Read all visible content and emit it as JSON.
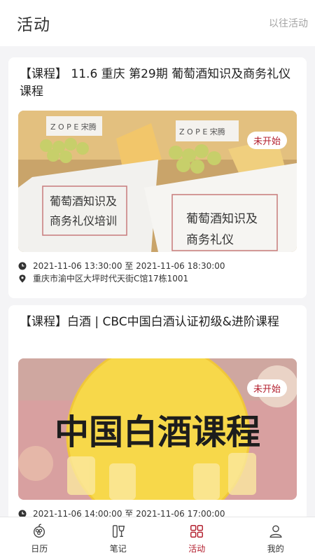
{
  "header": {
    "title": "活动",
    "past_events_label": "以往活动"
  },
  "activities": [
    {
      "title": "【课程】 11.6 重庆 第29期 葡萄酒知识及商务礼仪课程",
      "status_badge": "未开始",
      "image_texts": [
        "Z O P E 宋腾",
        "葡萄酒知识及",
        "商务礼仪培训",
        "葡萄酒知识及",
        "商务礼仪"
      ],
      "time": "2021-11-06 13:30:00 至 2021-11-06 18:30:00",
      "location": "重庆市渝中区大坪时代天街C馆17栋1001"
    },
    {
      "title": "【课程】白酒 | CBC中国白酒认证初级&进阶课程",
      "status_badge": "未开始",
      "image_texts": [
        "中国白酒课程"
      ],
      "time": "2021-11-06 14:00:00 至 2021-11-06 17:00:00"
    }
  ],
  "bottom_nav": [
    {
      "label": "日历",
      "icon": "calendar-icon",
      "active": false
    },
    {
      "label": "笔记",
      "icon": "wine-glass-icon",
      "active": false
    },
    {
      "label": "活动",
      "icon": "grid-icon",
      "active": true
    },
    {
      "label": "我的",
      "icon": "user-icon",
      "active": false
    }
  ],
  "colors": {
    "accent": "#b3202f",
    "background": "#f4f4f6",
    "muted_text": "#a3a3a3"
  }
}
